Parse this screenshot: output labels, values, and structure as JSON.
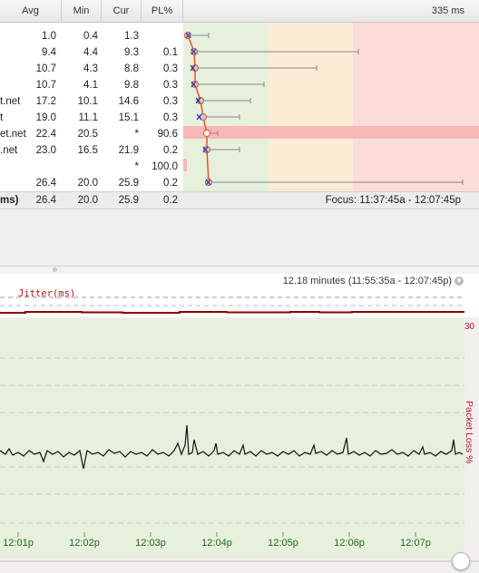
{
  "header": {
    "cols": [
      "Avg",
      "Min",
      "Cur",
      "PL%"
    ],
    "latency": "335 ms"
  },
  "rows": [
    {
      "name": "",
      "avg": "1.0",
      "min": "0.4",
      "cur": "1.3",
      "pl": ""
    },
    {
      "name": "",
      "avg": "9.4",
      "min": "4.4",
      "cur": "9.3",
      "pl": "0.1"
    },
    {
      "name": "",
      "avg": "10.7",
      "min": "4.3",
      "cur": "8.8",
      "pl": "0.3"
    },
    {
      "name": "",
      "avg": "10.7",
      "min": "4.1",
      "cur": "9.8",
      "pl": "0.3"
    },
    {
      "name": "t.net",
      "avg": "17.2",
      "min": "10.1",
      "cur": "14.6",
      "pl": "0.3"
    },
    {
      "name": "t",
      "avg": "19.0",
      "min": "11.1",
      "cur": "15.1",
      "pl": "0.3"
    },
    {
      "name": "et.net",
      "avg": "22.4",
      "min": "20.5",
      "cur": "*",
      "pl": "90.6"
    },
    {
      "name": ".net",
      "avg": "23.0",
      "min": "16.5",
      "cur": "21.9",
      "pl": "0.2"
    },
    {
      "name": "",
      "avg": "",
      "min": "",
      "cur": "*",
      "pl": "100.0"
    },
    {
      "name": "",
      "avg": "26.4",
      "min": "20.0",
      "cur": "25.9",
      "pl": "0.2"
    }
  ],
  "summary": {
    "name": "ms)",
    "avg": "26.4",
    "min": "20.0",
    "cur": "25.9",
    "pl": "0.2",
    "focus": "Focus: 11:37:45a - 12:07:45p"
  },
  "timeline": {
    "range": "12.18 minutes (11:55:35a - 12:07:45p)",
    "jitter_label": "Jitter(ms)",
    "axis_max": "30",
    "right_label": "Packet Loss %",
    "ticks": [
      "12:01p",
      "12:02p",
      "12:03p",
      "12:04p",
      "12:05p",
      "12:06p",
      "12:07p"
    ]
  },
  "colors": {
    "green": "#e6f0dc",
    "orange": "#fbecd6",
    "red": "#fcdcd9",
    "line": "#e8531e",
    "jitter": "#8b0000"
  }
}
